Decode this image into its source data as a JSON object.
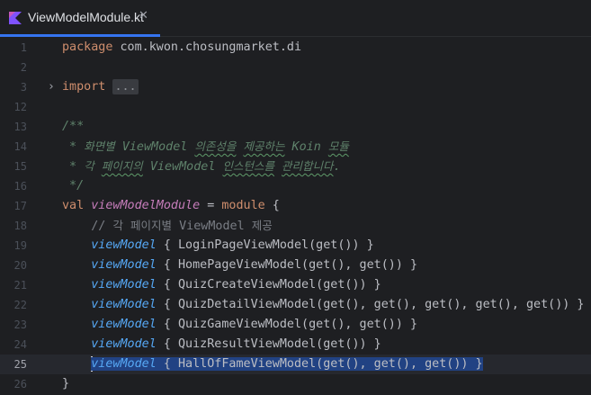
{
  "tab": {
    "title": "ViewModelModule.kt",
    "close_glyph": "✕",
    "icon": "kotlin-file-icon"
  },
  "lines": {
    "l1": {
      "num": "1",
      "kw": "package",
      "rest": " com.kwon.chosungmarket.di"
    },
    "l2": {
      "num": "2"
    },
    "l3": {
      "num": "3",
      "fold": "›",
      "kw": "import",
      "folded": "..."
    },
    "l12": {
      "num": "12"
    },
    "l13": {
      "num": "13",
      "text": "/**"
    },
    "l14": {
      "num": "14",
      "star": " * ",
      "t1": "화면별",
      "t2": " ViewModel ",
      "t3": "의존성을",
      "t4": " ",
      "t5": "제공하는",
      "t6": " Koin ",
      "t7": "모듈"
    },
    "l15": {
      "num": "15",
      "star": " * ",
      "t1": "각",
      "t2": " ",
      "t3": "페이지의",
      "t4": " ViewModel ",
      "t5": "인스턴스를",
      "t6": " ",
      "t7": "관리합니다",
      "t8": "."
    },
    "l16": {
      "num": "16",
      "text": " */"
    },
    "l17": {
      "num": "17",
      "kw": "val",
      "name": "viewModelModule",
      "eq": " = ",
      "fn": "module",
      "brace": " {"
    },
    "l18": {
      "num": "18",
      "indent": "    ",
      "prefix": "// ",
      "t1": "각",
      "t2": " ",
      "t3": "페이지별",
      "t4": " ViewModel ",
      "t5": "제공"
    },
    "l19": {
      "num": "19",
      "fn": "viewModel",
      "rest": " { LoginPageViewModel(get()) }"
    },
    "l20": {
      "num": "20",
      "fn": "viewModel",
      "rest": " { HomePageViewModel(get(), get()) }"
    },
    "l21": {
      "num": "21",
      "fn": "viewModel",
      "rest": " { QuizCreateViewModel(get()) }"
    },
    "l22": {
      "num": "22",
      "fn": "viewModel",
      "rest": " { QuizDetailViewModel(get(), get(), get(), get(), get()) }"
    },
    "l23": {
      "num": "23",
      "fn": "viewModel",
      "rest": " { QuizGameViewModel(get(), get()) }"
    },
    "l24": {
      "num": "24",
      "fn": "viewModel",
      "rest": " { QuizResultViewModel(get()) }"
    },
    "l25": {
      "num": "25",
      "fn": "viewModel",
      "rest": " { HallOfFameViewModel(get(), get(), get()) }"
    },
    "l26": {
      "num": "26",
      "text": "}"
    }
  },
  "colors": {
    "background": "#1e1f22",
    "keyword": "#cf8e6d",
    "function_call": "#56a8f5",
    "property": "#c77dbb",
    "doc_comment": "#5f826b",
    "line_comment": "#7a7e85",
    "selection": "#214283",
    "tab_underline": "#3574f0"
  }
}
